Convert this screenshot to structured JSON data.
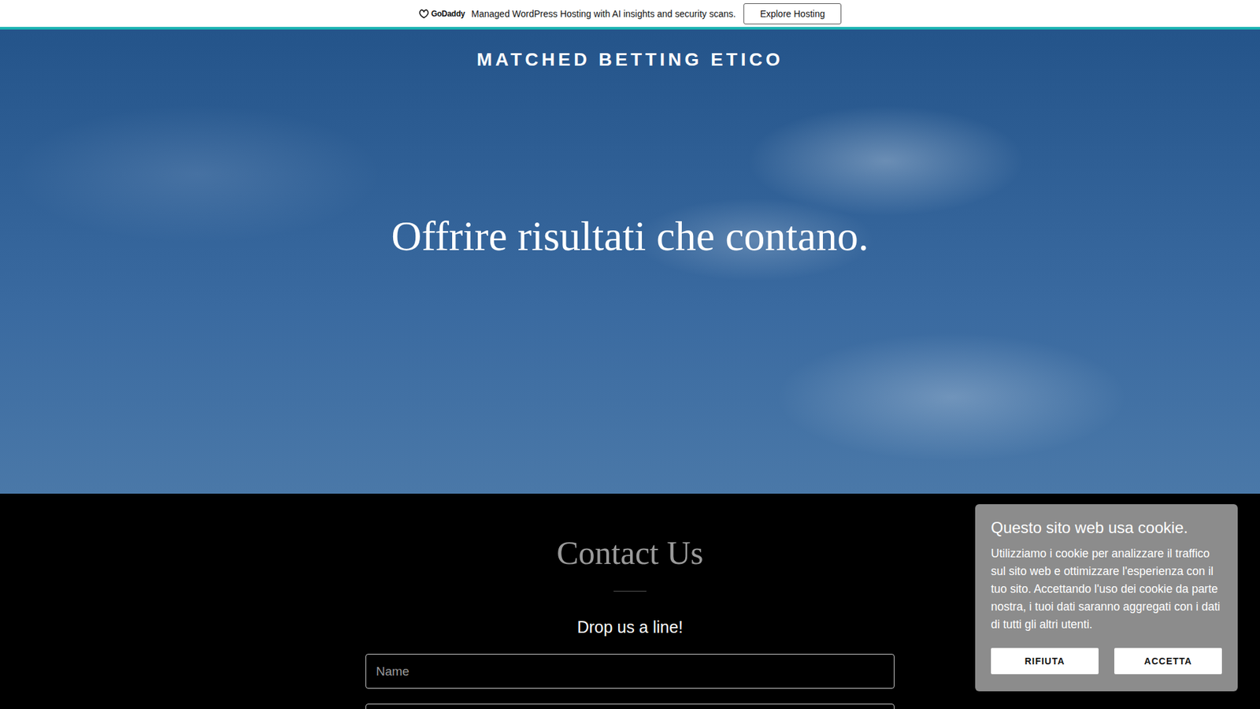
{
  "banner": {
    "logo": "GoDaddy",
    "text": "Managed WordPress Hosting with AI insights and security scans.",
    "button": "Explore Hosting"
  },
  "site_title": "MATCHED BETTING ETICO",
  "hero_heading": "Offrire risultati che contano.",
  "contact": {
    "title": "Contact Us",
    "subtitle": "Drop us a line!",
    "fields": [
      {
        "placeholder": "Name"
      },
      {
        "placeholder": ""
      }
    ]
  },
  "cookie": {
    "title": "Questo sito web usa cookie.",
    "text": "Utilizziamo i cookie per analizzare il traffico sul sito web e ottimizzare l'esperienza con il tuo sito. Accettando l'uso dei cookie da parte nostra, i tuoi dati saranno aggregati con i dati di tutti gli altri utenti.",
    "buttons": [
      "RIFIUTA",
      "ACCETTA"
    ]
  }
}
